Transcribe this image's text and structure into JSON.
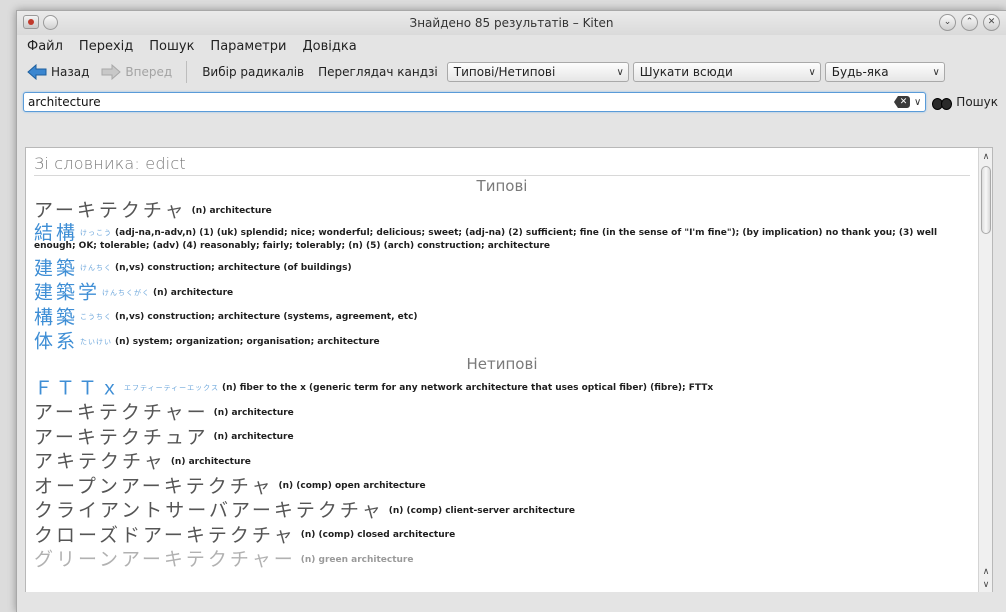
{
  "window": {
    "title": "Знайдено 85 результатів – Kiten",
    "controls": [
      "⌄",
      "⌃",
      "✕"
    ]
  },
  "menubar": {
    "items": [
      {
        "label": "Файл"
      },
      {
        "label": "Перехід"
      },
      {
        "label": "Пошук"
      },
      {
        "label": "Параметри"
      },
      {
        "label": "Довідка"
      }
    ]
  },
  "toolbar": {
    "back_label": "Назад",
    "forward_label": "Вперед",
    "radical_label": "Вибір радикалів",
    "kanji_label": "Переглядач кандзі",
    "filter_common": "Типові/Нетипові",
    "filter_scope": "Шукати всюди",
    "filter_match": "Будь-яка"
  },
  "search": {
    "value": "architecture",
    "button_label": "Пошук"
  },
  "results": {
    "dictionary_heading": "Зі словника: edict",
    "common_heading": "Типові",
    "uncommon_heading": "Нетипові",
    "common": [
      {
        "word": "アーキテクチャ",
        "reading": "",
        "meaning": "(n) architecture",
        "blue": false
      },
      {
        "word": "結構",
        "reading": "けっこう",
        "meaning": "(adj-na,n-adv,n) (1) (uk) splendid; nice; wonderful; delicious; sweet; (adj-na) (2) sufficient; fine (in the sense of \"I'm fine\"); (by implication) no thank you; (3) well enough; OK; tolerable; (adv) (4) reasonably; fairly; tolerably; (n) (5) (arch) construction; architecture",
        "blue": true
      },
      {
        "word": "建築",
        "reading": "けんちく",
        "meaning": "(n,vs) construction; architecture (of buildings)",
        "blue": true
      },
      {
        "word": "建築学",
        "reading": "けんちくがく",
        "meaning": "(n) architecture",
        "blue": true
      },
      {
        "word": "構築",
        "reading": "こうちく",
        "meaning": "(n,vs) construction; architecture (systems, agreement, etc)",
        "blue": true
      },
      {
        "word": "体系",
        "reading": "たいけい",
        "meaning": "(n) system; organization; organisation; architecture",
        "blue": true
      }
    ],
    "uncommon": [
      {
        "word": "ＦＴＴｘ",
        "reading": "エフティーティーエックス",
        "meaning": "(n) fiber to the x (generic term for any network architecture that uses optical fiber) (fibre); FTTx",
        "blue": true
      },
      {
        "word": "アーキテクチャー",
        "reading": "",
        "meaning": "(n) architecture",
        "blue": false
      },
      {
        "word": "アーキテクチュア",
        "reading": "",
        "meaning": "(n) architecture",
        "blue": false
      },
      {
        "word": "アキテクチャ",
        "reading": "",
        "meaning": "(n) architecture",
        "blue": false
      },
      {
        "word": "オープンアーキテクチャ",
        "reading": "",
        "meaning": "(n) (comp) open architecture",
        "blue": false
      },
      {
        "word": "クライアントサーバアーキテクチャ",
        "reading": "",
        "meaning": "(n) (comp) client-server architecture",
        "blue": false
      },
      {
        "word": "クローズドアーキテクチャ",
        "reading": "",
        "meaning": "(n) (comp) closed architecture",
        "blue": false
      },
      {
        "word": "グリーンアーキテクチャー",
        "reading": "",
        "meaning": "(n) green architecture",
        "blue": false
      }
    ]
  },
  "colors": {
    "accent_blue": "#3e8ed5",
    "reading_blue": "#6fa8dc",
    "input_focus": "#5a9bd8"
  }
}
